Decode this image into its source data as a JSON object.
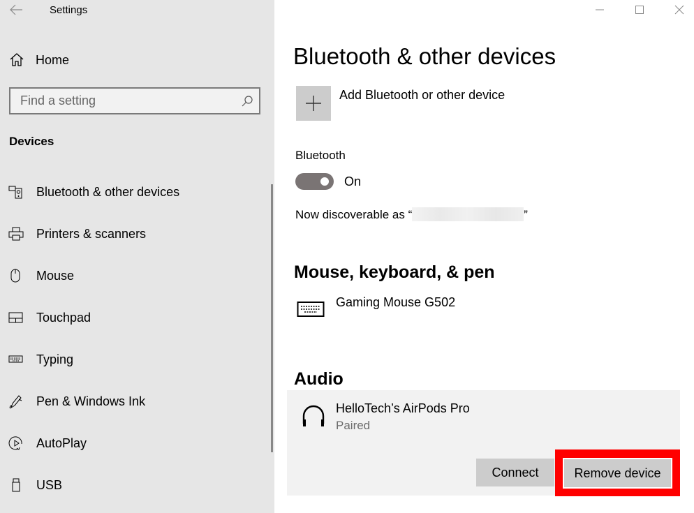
{
  "window": {
    "title": "Settings",
    "controls": {
      "minimize": "minimize",
      "maximize": "maximize",
      "close": "close"
    }
  },
  "sidebar": {
    "home_label": "Home",
    "search_placeholder": "Find a setting",
    "section_label": "Devices",
    "items": [
      {
        "label": "Bluetooth & other devices",
        "icon": "bluetooth-devices-icon"
      },
      {
        "label": "Printers & scanners",
        "icon": "printer-icon"
      },
      {
        "label": "Mouse",
        "icon": "mouse-icon"
      },
      {
        "label": "Touchpad",
        "icon": "touchpad-icon"
      },
      {
        "label": "Typing",
        "icon": "keyboard-icon"
      },
      {
        "label": "Pen & Windows Ink",
        "icon": "pen-icon"
      },
      {
        "label": "AutoPlay",
        "icon": "autoplay-icon"
      },
      {
        "label": "USB",
        "icon": "usb-icon"
      }
    ]
  },
  "main": {
    "title": "Bluetooth & other devices",
    "add_device_label": "Add Bluetooth or other device",
    "bluetooth_label": "Bluetooth",
    "bluetooth_state": "On",
    "discoverable_prefix": "Now discoverable as “",
    "discoverable_suffix": "”",
    "sections": {
      "input": {
        "heading": "Mouse, keyboard, & pen",
        "devices": [
          {
            "name": "Gaming Mouse G502",
            "icon": "keyboard-icon"
          }
        ]
      },
      "audio": {
        "heading": "Audio",
        "devices": [
          {
            "name": "HelloTech’s AirPods Pro",
            "status": "Paired",
            "icon": "headphones-icon"
          }
        ]
      }
    },
    "buttons": {
      "connect": "Connect",
      "remove": "Remove device"
    },
    "highlight_color": "#ff0000"
  }
}
